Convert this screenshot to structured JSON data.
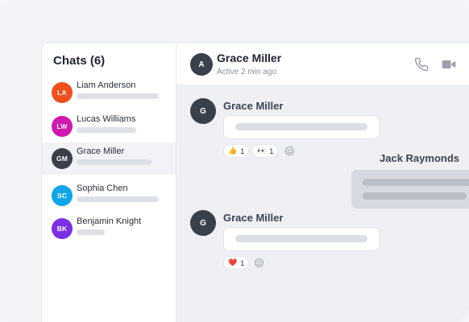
{
  "sidebar": {
    "title": "Chats (6)",
    "chats": [
      {
        "initials": "LA",
        "name": "Liam Anderson",
        "color": "#f0501e"
      },
      {
        "initials": "LW",
        "name": "Lucas Williams",
        "color": "#d018b0"
      },
      {
        "initials": "GM",
        "name": "Grace Miller",
        "color": "#3a3f4c"
      },
      {
        "initials": "SC",
        "name": "Sophia Chen",
        "color": "#0ea5e9"
      },
      {
        "initials": "BK",
        "name": "Benjamin Knight",
        "color": "#7c2ee6"
      }
    ]
  },
  "header": {
    "initials": "A",
    "name": "Grace Miller",
    "status": "Active 2 min ago",
    "phone_icon": "phone-icon",
    "video_icon": "video-icon"
  },
  "messages": [
    {
      "initials": "G",
      "sender": "Grace Miller",
      "reactions": [
        {
          "emoji": "👍",
          "count": "1"
        },
        {
          "emoji": "👀",
          "count": "1"
        }
      ]
    },
    {
      "sender": "Jack Raymonds"
    },
    {
      "initials": "G",
      "sender": "Grace Miller",
      "reactions": [
        {
          "emoji": "❤️",
          "count": "1"
        }
      ]
    }
  ],
  "colors": {
    "accent_dark": "#3a3f4c",
    "icon_gray": "#9ba1ad",
    "heart": "#e5243b"
  }
}
